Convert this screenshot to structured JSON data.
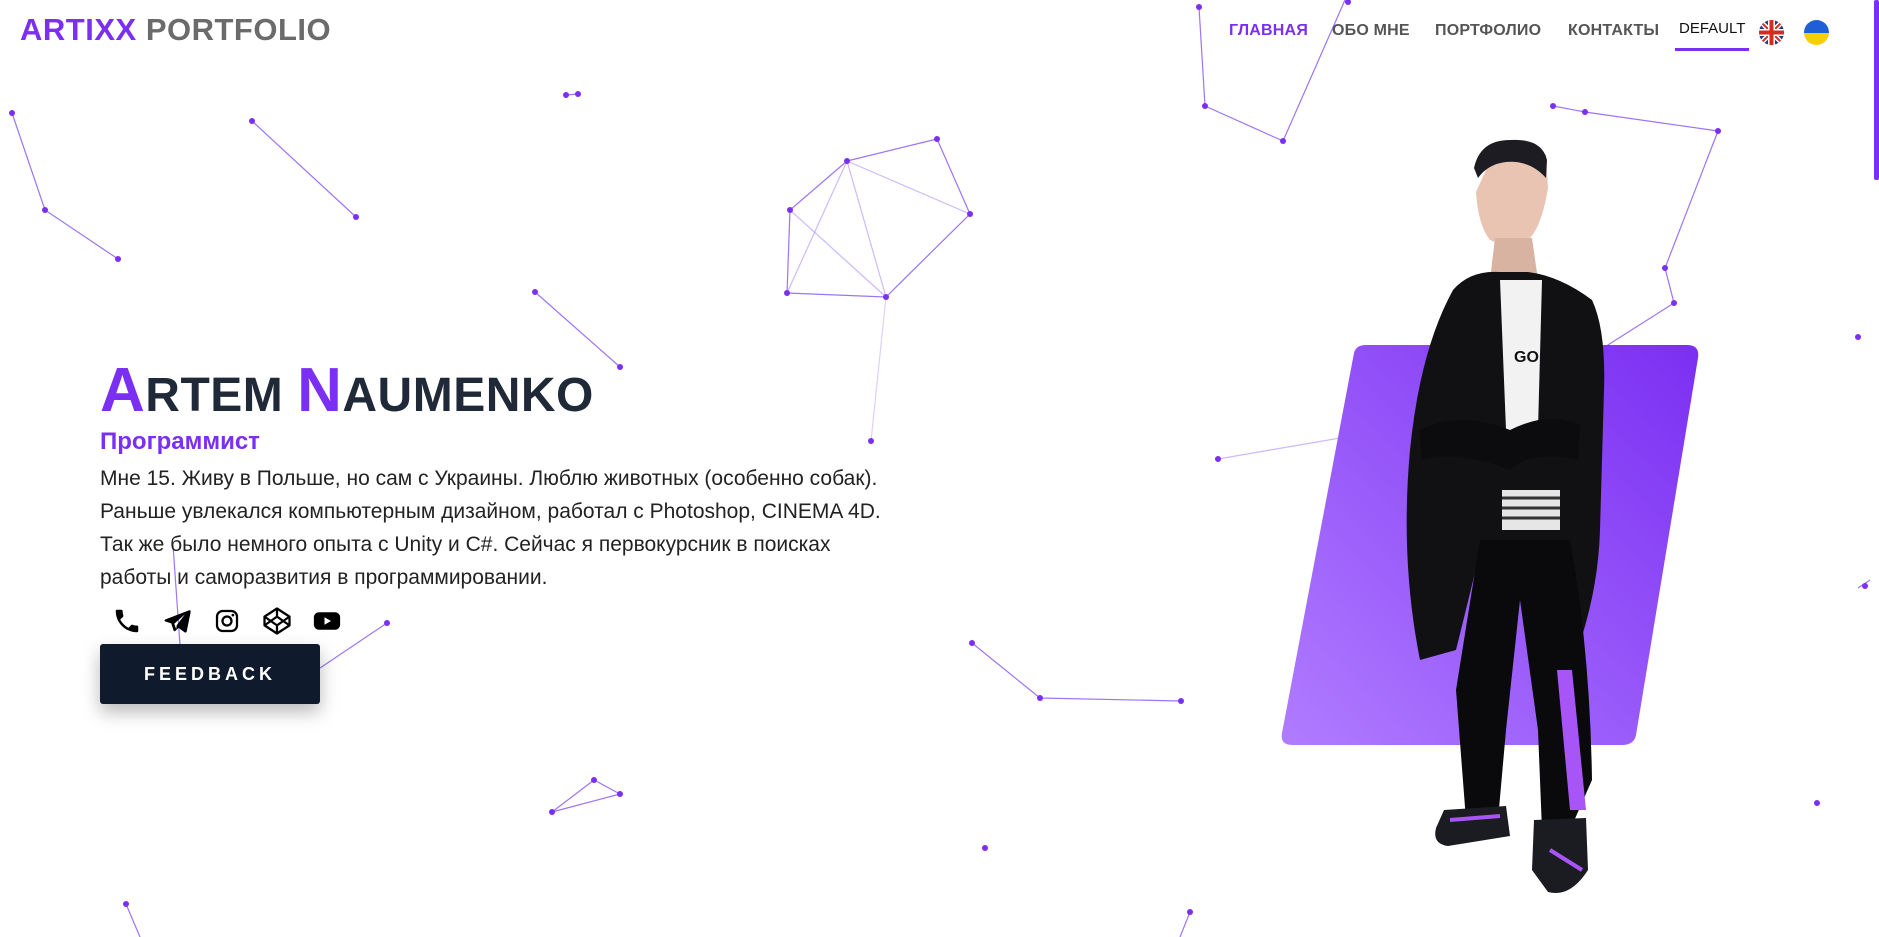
{
  "header": {
    "logo_primary": "ARTIXX",
    "logo_secondary": "PORTFOLIO",
    "nav": [
      {
        "label": "ГЛАВНАЯ",
        "active": true
      },
      {
        "label": "ОБО МНЕ",
        "active": false
      },
      {
        "label": "ПОРТФОЛИО",
        "active": false
      },
      {
        "label": "КОНТАКТЫ",
        "active": false
      }
    ],
    "theme_label": "DEFAULT",
    "languages": [
      "english-flag-icon",
      "ukraine-flag-icon"
    ]
  },
  "hero": {
    "name_first_initial": "A",
    "name_first_rest": "RTEM",
    "name_last_initial": "N",
    "name_last_rest": "AUMENKO",
    "role": "Программист",
    "bio": "Мне 15. Живу в Польше, но сам с Украины. Люблю животных (особенно собак). Раньше увлекался компьютерным дизайном, работал с Photoshop, CINEMA 4D. Так же было немного опыта с Unity и C#. Сейчас я первокурсник в поисках работы и саморазвития в программировании.",
    "socials": [
      "phone-icon",
      "telegram-icon",
      "instagram-icon",
      "codepen-icon",
      "youtube-icon"
    ],
    "cta_label": "FEEDBACK"
  },
  "colors": {
    "accent": "#7b2ff2",
    "dark": "#1f2937",
    "button": "#0f1b2d"
  }
}
